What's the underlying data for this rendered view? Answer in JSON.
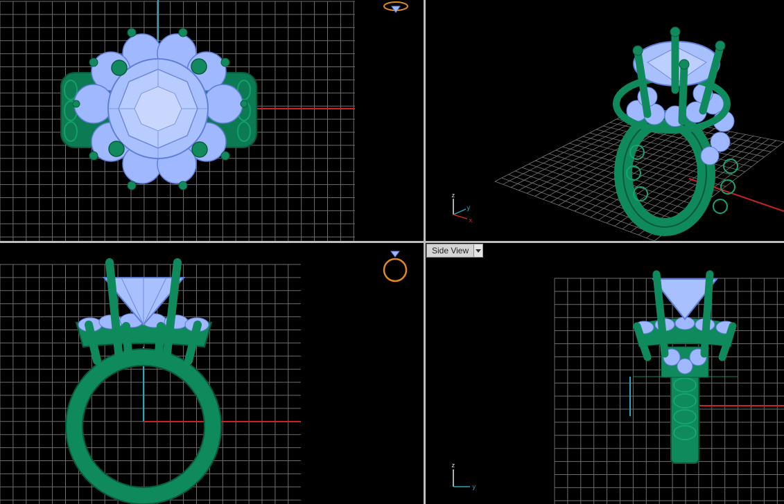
{
  "viewports": {
    "top_left": {
      "name": "top"
    },
    "top_right": {
      "name": "perspective",
      "axis_labels": {
        "z": "z",
        "y": "y",
        "x": "x"
      }
    },
    "bottom_left": {
      "name": "front"
    },
    "bottom_right": {
      "name": "side",
      "label": "Side View",
      "axis_labels": {
        "z": "z",
        "y": "y"
      }
    }
  },
  "colors": {
    "background": "#000000",
    "grid": "#6e6e6e",
    "metal": "#0f8a5c",
    "gem": "#9fb8ff",
    "axis_x": "#cc2222",
    "axis_y": "#2aa7b8",
    "axis_z": "#e6e6e6",
    "orientation_icon": "#e08a1e"
  },
  "icons": [
    "ring-orientation-icon",
    "ring-orientation-icon",
    "axis-gizmo-icon",
    "axis-gizmo-icon",
    "chevron-down-icon"
  ]
}
